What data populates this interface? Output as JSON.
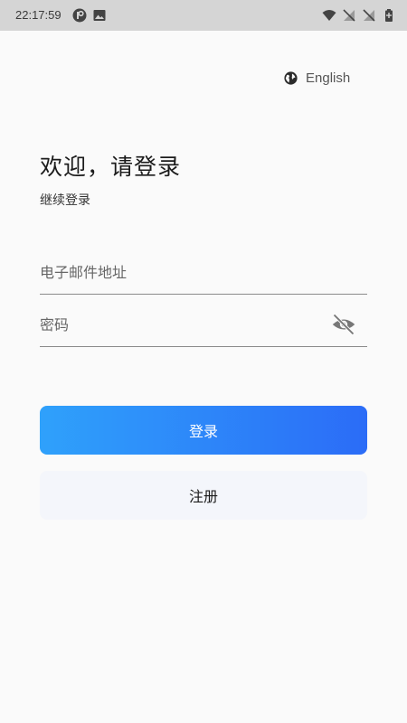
{
  "status_bar": {
    "time": "22:17:59",
    "icons": [
      "app-notification-icon",
      "image-notification-icon",
      "wifi-icon",
      "signal-off-icon",
      "signal-off-icon",
      "battery-icon"
    ]
  },
  "language": {
    "label": "English",
    "icon": "globe-icon"
  },
  "welcome": {
    "title": "欢迎，请登录",
    "subtitle": "继续登录"
  },
  "form": {
    "email_placeholder": "电子邮件地址",
    "password_placeholder": "密码",
    "password_toggle_icon": "eye-off-icon"
  },
  "buttons": {
    "login_label": "登录",
    "register_label": "注册"
  },
  "colors": {
    "login_gradient_start": "#2fa1fb",
    "login_gradient_end": "#2b6cf7",
    "register_bg": "#f4f6fb",
    "background": "#fafafa"
  }
}
